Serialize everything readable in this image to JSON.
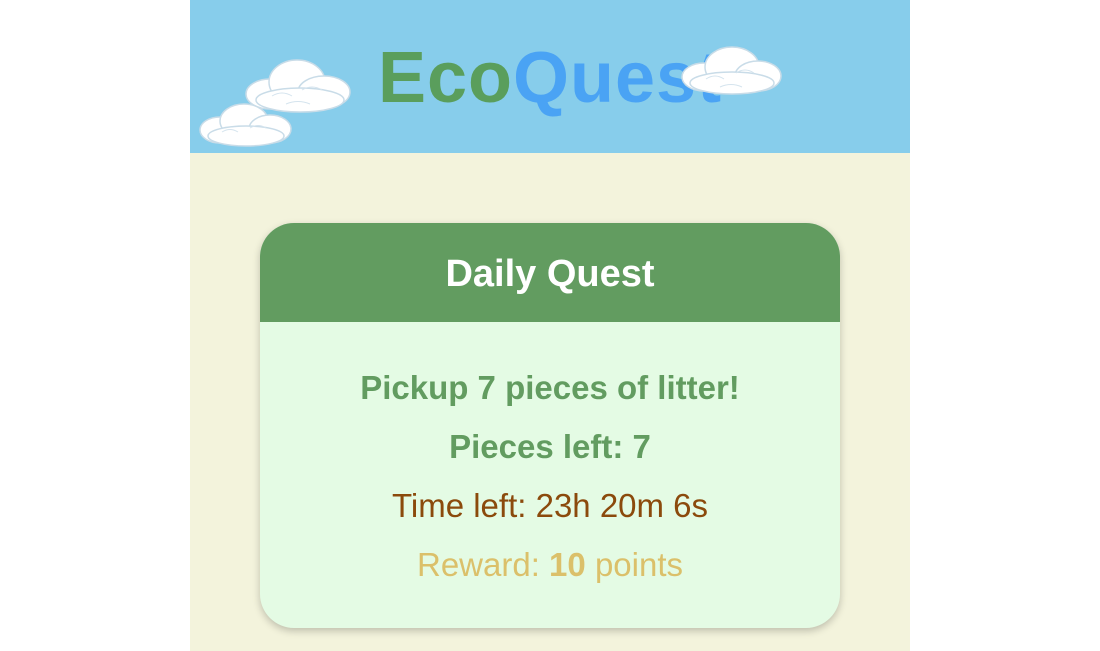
{
  "app": {
    "title_part1": "Eco",
    "title_part2": "Quest"
  },
  "quest": {
    "title": "Daily Quest",
    "task": "Pickup 7 pieces of litter!",
    "pieces_label": "Pieces left: 7",
    "time_label": "Time left: 23h 20m 6s",
    "reward_prefix": "Reward:",
    "reward_points": "10",
    "reward_suffix": "points"
  },
  "colors": {
    "sky": "#87cdeb",
    "background": "#f3f3dc",
    "eco_green": "#5a9e5c",
    "quest_blue": "#4aa3f4",
    "card_header": "#629c60",
    "card_body": "#e4fbe4",
    "time_brown": "#8b4a0c",
    "reward_gold": "#dbc06a"
  },
  "icons": [
    "cloud-icon"
  ]
}
